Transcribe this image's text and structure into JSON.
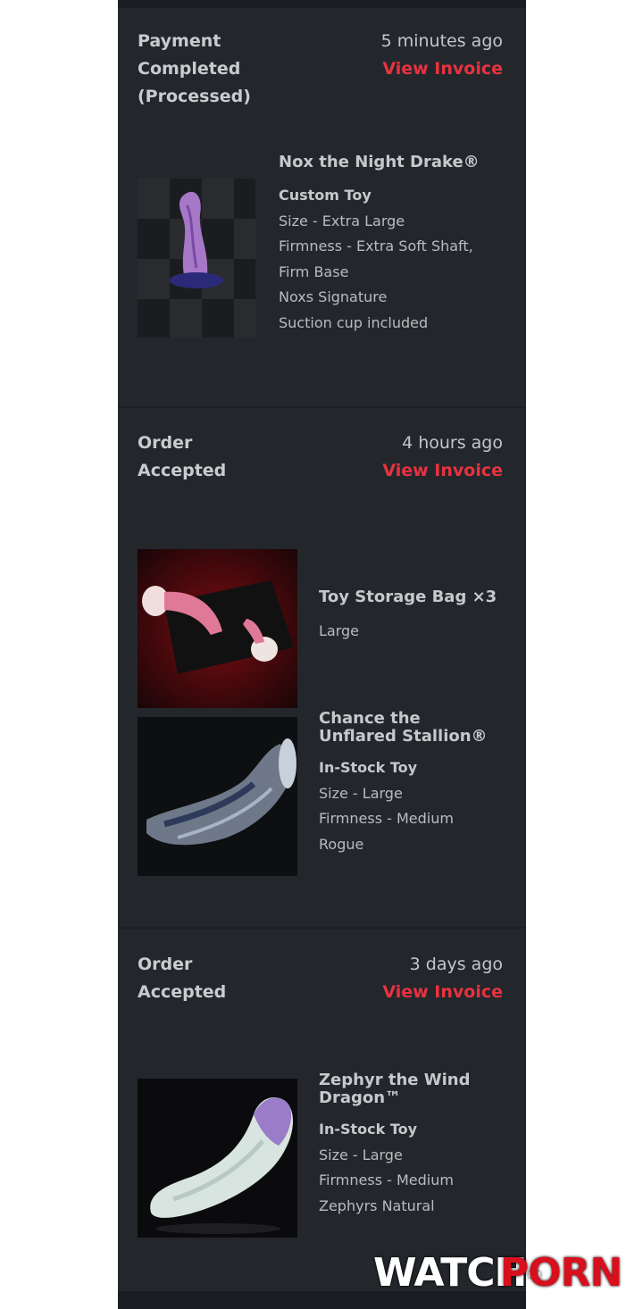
{
  "orders": [
    {
      "status_lines": [
        "Payment",
        "Completed",
        "(Processed)"
      ],
      "time": "5 minutes ago",
      "invoice_label": "View Invoice",
      "items": [
        {
          "name": "Nox the Night Drake®",
          "type": "Custom Toy",
          "details": [
            "Size - Extra Large",
            "Firmness - Extra Soft Shaft,",
            "Firm Base",
            "Noxs Signature",
            "Suction cup included"
          ]
        }
      ]
    },
    {
      "status_lines": [
        "Order",
        "Accepted"
      ],
      "time": "4 hours ago",
      "invoice_label": "View Invoice",
      "items": [
        {
          "name": "Toy Storage Bag ×3",
          "details": [
            "Large"
          ]
        },
        {
          "name_lines": [
            "Chance the",
            "Unflared Stallion®"
          ],
          "type": "In-Stock Toy",
          "details": [
            "Size - Large",
            "Firmness - Medium",
            "Rogue"
          ]
        }
      ]
    },
    {
      "status_lines": [
        "Order",
        "Accepted"
      ],
      "time": "3 days ago",
      "invoice_label": "View Invoice",
      "items": [
        {
          "name_lines": [
            "Zephyr the Wind",
            "Dragon™"
          ],
          "type": "In-Stock Toy",
          "details": [
            "Size - Large",
            "Firmness - Medium",
            "Zephyrs Natural"
          ]
        }
      ]
    }
  ],
  "watermark": {
    "part1": "WATCH-",
    "part2": "PORN"
  },
  "colors": {
    "background": "#23272c",
    "accent": "#e8323f",
    "text": "#c6c8cb"
  }
}
